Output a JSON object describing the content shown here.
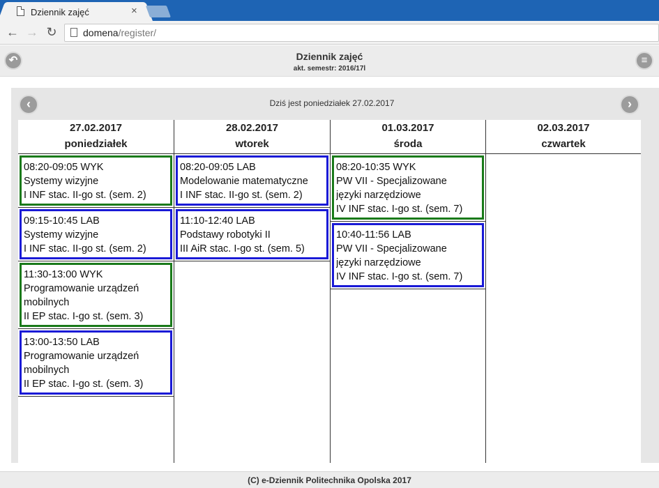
{
  "browser": {
    "tab_title": "Dziennik zajęć",
    "tab_close": "×",
    "url_domain": "domena",
    "url_path": "/register/"
  },
  "header": {
    "title": "Dziennik zajęć",
    "subtitle": "akt. semestr: 2016/17l"
  },
  "schedule": {
    "today_text": "Dziś jest poniedziałek 27.02.2017",
    "days": [
      {
        "date": "27.02.2017",
        "weekday": "poniedziałek",
        "classes": [
          {
            "type": "WYK",
            "time": "08:20-09:05 WYK",
            "subject": [
              "Systemy wizyjne"
            ],
            "group": "I INF stac. II-go st. (sem. 2)"
          },
          {
            "type": "LAB",
            "time": "09:15-10:45 LAB",
            "subject": [
              "Systemy wizyjne"
            ],
            "group": "I INF stac. II-go st. (sem. 2)"
          },
          {
            "type": "WYK",
            "time": "11:30-13:00 WYK",
            "subject": [
              "Programowanie urządzeń",
              "mobilnych"
            ],
            "group": "II EP stac. I-go st. (sem. 3)"
          },
          {
            "type": "LAB",
            "time": "13:00-13:50 LAB",
            "subject": [
              "Programowanie urządzeń",
              "mobilnych"
            ],
            "group": "II EP stac. I-go st. (sem. 3)"
          }
        ]
      },
      {
        "date": "28.02.2017",
        "weekday": "wtorek",
        "classes": [
          {
            "type": "LAB",
            "time": "08:20-09:05 LAB",
            "subject": [
              "Modelowanie matematyczne"
            ],
            "group": "I INF stac. II-go st. (sem. 2)"
          },
          {
            "type": "LAB",
            "time": "11:10-12:40 LAB",
            "subject": [
              "Podstawy robotyki II"
            ],
            "group": "III AiR stac. I-go st. (sem. 5)"
          }
        ]
      },
      {
        "date": "01.03.2017",
        "weekday": "środa",
        "classes": [
          {
            "type": "WYK",
            "time": "08:20-10:35 WYK",
            "subject": [
              "PW VII - Specjalizowane",
              "języki narzędziowe"
            ],
            "group": "IV INF stac. I-go st. (sem. 7)"
          },
          {
            "type": "LAB",
            "time": "10:40-11:56 LAB",
            "subject": [
              "PW VII - Specjalizowane",
              "języki narzędziowe"
            ],
            "group": "IV INF stac. I-go st. (sem. 7)"
          }
        ]
      },
      {
        "date": "02.03.2017",
        "weekday": "czwartek",
        "classes": []
      }
    ]
  },
  "footer": {
    "text": "(C) e-Dziennik Politechnika Opolska 2017"
  },
  "colors": {
    "wyk_border": "#1a7a1a",
    "lab_border": "#1a1ad6",
    "chrome_blue": "#1e64b4"
  },
  "icons": {
    "back": "back-arrow-icon",
    "forward": "forward-arrow-icon",
    "reload": "reload-icon",
    "app_back": "undo-circle-icon",
    "menu": "hamburger-menu-icon",
    "prev": "chevron-left-icon",
    "next": "chevron-right-icon"
  }
}
